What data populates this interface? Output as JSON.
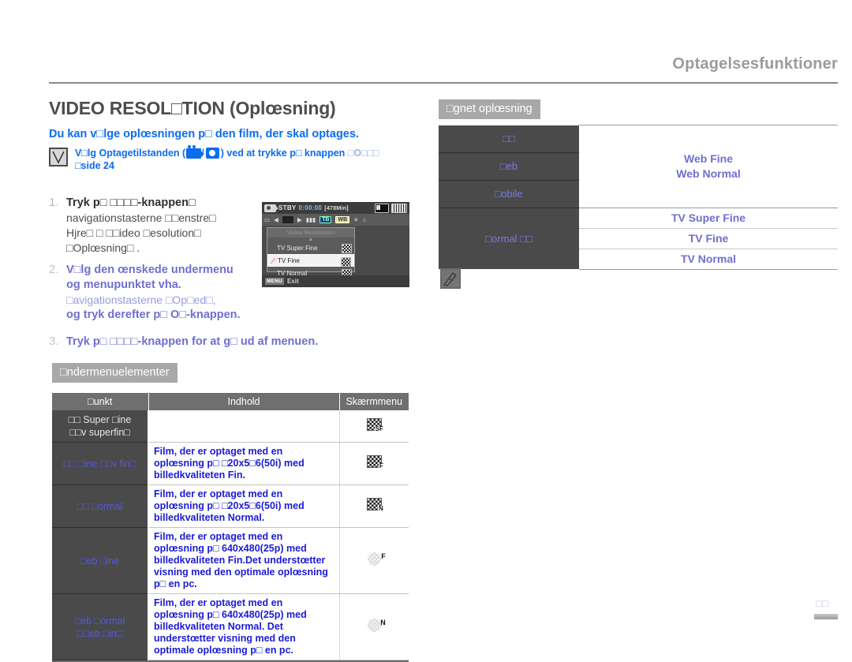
{
  "header": {
    "title": "Optagelsesfunktioner"
  },
  "section": {
    "title": "VIDEO RESOL□TION (Oplœsning)",
    "lead": "Du kan v□lge oplœsningen p□ den film, der skal optages.",
    "mode_note_line1": "V□lg Optagetilstanden (",
    "mode_note_mid": "/",
    "mode_note_line1_end": ") ved at trykke p□ knappen",
    "mode_note_tail": "□O□□□",
    "mode_note_line2": "□side 24"
  },
  "steps": [
    {
      "num": "1.",
      "line1": "Tryk p□ □□□□-knappen□",
      "line2": "navigationstasterne □□enstre□",
      "line3": "Hjre□  □ □□ideo □esolution□",
      "line4": "□Oplœsning□ ."
    },
    {
      "num": "2.",
      "line1": "V□lg den œnskede undermenu",
      "line2": "og menupunktet vha.",
      "line3": "□avigationstasterne   □Op□ed□,",
      "line4": "og tryk derefter p□ O□-knappen."
    },
    {
      "num": "3.",
      "line1": "Tryk p□ □□□□-knappen for at g□ ud af menuen."
    }
  ],
  "camera_lcd": {
    "status_stby": "STBY",
    "status_time": "0:00:00",
    "status_capacity": "[478Min]",
    "menu_title": "Video Resolution",
    "rows": [
      {
        "label": "TV Super Fine",
        "selected": false
      },
      {
        "label": "TV Fine",
        "selected": true
      },
      {
        "label": "TV Normal",
        "selected": false
      }
    ],
    "menu_key": "MENU",
    "menu_action": "Exit",
    "icon_blue_label": "TB",
    "icon_yellow_label": "WB"
  },
  "suited": {
    "caption": "□gnet oplœsning",
    "rows": [
      {
        "left": "□□",
        "right": "",
        "right_group": false
      },
      {
        "left": "□eb",
        "right": "Web Fine\nWeb Normal",
        "right_group": true
      },
      {
        "left": "□obile",
        "right": "",
        "right_group": false
      },
      {
        "left": "□ormal □□",
        "right": "TV Super Fine",
        "right_group": false
      },
      {
        "left": "",
        "right": "TV Fine",
        "right_group": false
      },
      {
        "left": "",
        "right": "TV Normal",
        "right_group": false
      }
    ],
    "left_labels": [
      "□□",
      "□eb",
      "□obile",
      "□ormal □□"
    ],
    "right_web": [
      "Web Fine",
      "Web Normal"
    ],
    "right_tv": [
      "TV Super Fine",
      "TV Fine",
      "TV Normal"
    ]
  },
  "submenu": {
    "caption": "□ndermenuelementer",
    "headers": [
      "□unkt",
      "Indhold",
      "Skærmmenu"
    ],
    "rows": [
      {
        "key": "□□ Super □ine",
        "key2": "□□v superfin□",
        "value": "",
        "osd_type": "tv",
        "osd_tag": "SF"
      },
      {
        "key": "□□ □ine □□v fin□",
        "key2": "",
        "value": "Film, der er optaget med en oplœsning p□ □20x5□6(50i) med billedkvaliteten Fin.",
        "osd_type": "tv",
        "osd_tag": "F"
      },
      {
        "key": "□□ □ormal",
        "key2": "",
        "value": "Film, der er optaget med en oplœsning p□ □20x5□6(50i) med billedkvaliteten Normal.",
        "osd_type": "tv",
        "osd_tag": "N"
      },
      {
        "key": "□eb □ine",
        "key2": "",
        "value": "Film, der er optaget med en oplœsning p□ 640x480(25p) med billedkvaliteten Fin.Det understœtter visning med den optimale oplœsning p□ en pc.",
        "osd_type": "web",
        "osd_tag": "F"
      },
      {
        "key": "□eb □ormal",
        "key2": "□□eb □in□",
        "value": "Film, der er optaget med en oplœsning p□ 640x480(25p) med billedkvaliteten Normal. Det understœtter visning med den optimale oplœsning p□ en pc.",
        "osd_type": "web",
        "osd_tag": "N"
      }
    ]
  },
  "footer": {
    "page_number": "□□"
  },
  "colors": {
    "accent_blue": "#0b6cf0",
    "muted_purple": "#6f6fd0",
    "table_dark": "#4a4a4a",
    "caption_gray": "#a8a8a8",
    "header_gray": "#9b9b9b"
  }
}
